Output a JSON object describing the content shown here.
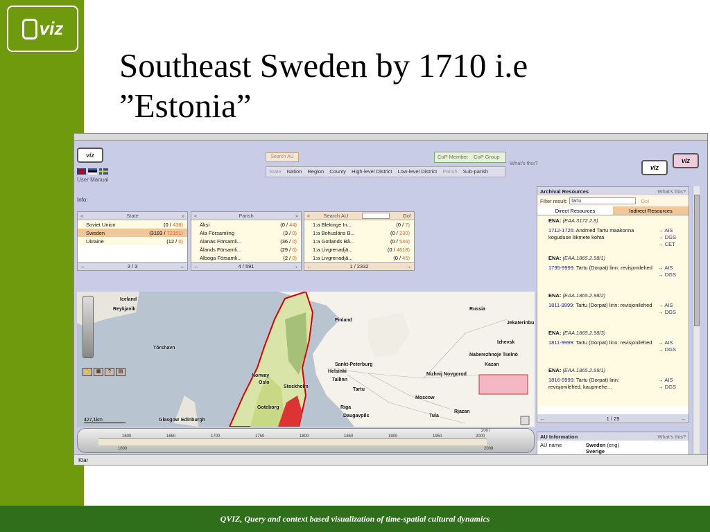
{
  "slide": {
    "title_line1": "Southeast Sweden by 1710 i.e",
    "title_line2": "”Estonia”",
    "logo_text": "viz",
    "footer": "QVIZ, Query and context based visualization of time-spatial cultural dynamics"
  },
  "app": {
    "logo": "viz",
    "user_manual": "User Manual",
    "info_label": "Info:",
    "search_au_button": "Search AU",
    "levels": [
      "State",
      "Nation",
      "Region",
      "County",
      "High-level District",
      "Low-level District",
      "Parish",
      "Sub-parish"
    ],
    "cop": [
      "CoP Member",
      "CoP Group"
    ],
    "whats_this": "What's this?",
    "status_text": "Klar"
  },
  "state_panel": {
    "prev": "«",
    "next": "»",
    "header": "State",
    "rows": [
      {
        "name": "Soviet Union",
        "count": "(0 /",
        "total": "438)",
        "sel": false
      },
      {
        "name": "Sweden",
        "count": "(3183 /",
        "total": "72151)",
        "sel": true
      },
      {
        "name": "Ukraine",
        "count": "(12 /",
        "total": "0)",
        "sel": false
      }
    ],
    "footer_prev": "←",
    "page": "3 / 3",
    "footer_next": "→"
  },
  "parish_panel": {
    "prev": "«",
    "next": "»",
    "header": "Parish",
    "rows": [
      {
        "name": "Äksi",
        "count": "(0 /",
        "total": "44)"
      },
      {
        "name": "Ala Församling",
        "count": "(3 /",
        "total": "0)"
      },
      {
        "name": "Alanäs Församli...",
        "count": "(36 /",
        "total": "0)"
      },
      {
        "name": "Ålands Församli...",
        "count": "(29 /",
        "total": "0)"
      },
      {
        "name": "Alboga Församli...",
        "count": "(2 /",
        "total": "0)"
      }
    ],
    "footer_prev": "←",
    "page": "4 / 591",
    "footer_next": "→"
  },
  "au_panel": {
    "prev": "«",
    "header": "Search AU",
    "go": "Go!",
    "rows": [
      {
        "name": "1:a Blekinge In...",
        "count": "(0 /",
        "total": "7)"
      },
      {
        "name": "1:a Bohusläns B...",
        "count": "(0 /",
        "total": "230)"
      },
      {
        "name": "1:a Gotlands Bå...",
        "count": "(0 /",
        "total": "546)"
      },
      {
        "name": "1:a Livgrenadjä...",
        "count": "(0 /",
        "total": "4618)"
      },
      {
        "name": "1:a Livgrenadjä...",
        "count": "(0 /",
        "total": "45)"
      }
    ],
    "footer_prev": "←",
    "page": "1 / 2332",
    "footer_next": "→"
  },
  "map": {
    "labels": [
      "Iceland",
      "Reykjavik",
      "Tórshavn",
      "Finland",
      "Russia",
      "Jekaterinbu",
      "Izhevsk",
      "Naberezhnoje Tselnö",
      "Kazan",
      "Sankt-Peterburg",
      "Helsinki",
      "Tallinn",
      "Norway",
      "Oslo",
      "Stockholm",
      "Nizhnij Novgorod",
      "Tartu",
      "Moscow",
      "Goteborg",
      "Riga",
      "Daugavpils",
      "Tula",
      "Rjazan",
      "Glasgow",
      "Edinburgh"
    ],
    "scale": "427,1km"
  },
  "timeline": {
    "years": [
      "1600",
      "1650",
      "1700",
      "1750",
      "1800",
      "1850",
      "1900",
      "1950",
      "2000"
    ],
    "marker": "2007",
    "start": "1600",
    "end": "2008"
  },
  "archive": {
    "title": "Archival Resources",
    "whats_this": "What's this?",
    "filter_label": "Filter result:",
    "filter_value": "tartu",
    "go": "Go!",
    "tab_direct": "Direct Resources",
    "tab_indirect": "Indirect Resources",
    "items": [
      {
        "ena": "ENA:",
        "code": "(EAA.3172.2.8)",
        "date": "1712-1726:",
        "text": "Andmed Tartu maakonna koguduse liikmete kohta",
        "links": [
          "→ AIS",
          "→ DGS",
          "→ CET"
        ]
      },
      {
        "ena": "ENA:",
        "code": "(EAA.1865.2.98/1)",
        "date": "1795-9999:",
        "text": "Tartu (Dorpat) linn: revisjonilehed",
        "links": [
          "→ AIS",
          "→ DGS"
        ]
      },
      {
        "ena": "ENA:",
        "code": "(EAA.1865.2.98/2)",
        "date": "1811-9999:",
        "text": "Tartu (Dorpat) linn: revisjonilehed",
        "links": [
          "→ AIS",
          "→ DGS"
        ]
      },
      {
        "ena": "ENA:",
        "code": "(EAA.1865.2.98/3)",
        "date": "1811-9999:",
        "text": "Tartu (Dorpat) linn: revisjonilehed",
        "links": [
          "→ AIS",
          "→ DGS"
        ]
      },
      {
        "ena": "ENA:",
        "code": "(EAA.1865.2.99/1)",
        "date": "1816-9999:",
        "text": "Tartu (Dorpat) linn: revisjonilehed, kaupmehe...",
        "links": [
          "→ AIS",
          "→ DGS"
        ]
      }
    ],
    "footer_prev": "←",
    "page": "1 / 29",
    "footer_next": "→"
  },
  "au_info": {
    "title": "AU Information",
    "whats_this": "What's this?",
    "key": "AU name",
    "value": "Sweden",
    "value_lang": "(eng)",
    "value2": "Sverige"
  }
}
